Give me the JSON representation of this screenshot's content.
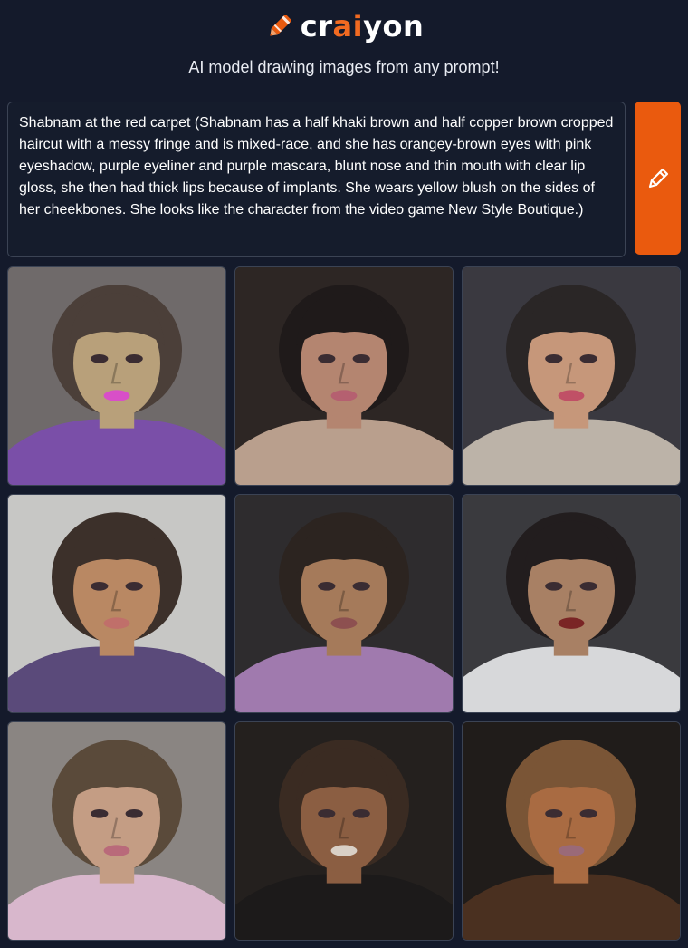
{
  "header": {
    "logo_prefix": "cr",
    "logo_accent": "ai",
    "logo_suffix": "yon",
    "logo_icon": "crayon-pencil-icon",
    "tagline": "AI model drawing images from any prompt!"
  },
  "prompt": {
    "text": "Shabnam at the red carpet (Shabnam has a half khaki brown and half copper brown cropped haircut with a messy fringe and is mixed-race, and she has orangey-brown eyes with pink eyeshadow, purple eyeliner and purple mascara, blunt nose and thin mouth with clear lip gloss, she then had thick lips because of implants. She wears yellow blush on the sides of her cheekbones. She looks like the character from the video game New Style Boutique.)"
  },
  "draw_button": {
    "icon": "pencil-icon"
  },
  "colors": {
    "background": "#141a2b",
    "accent": "#ea5a0e",
    "logo_accent": "#f26a21",
    "border": "#3b4354"
  },
  "images": [
    {
      "label": "generated-image-1",
      "bg": "#6f6a6a",
      "skin": "#b8a07a",
      "hair": "#4b3f39",
      "cloth": "#7a4fa8",
      "lips": "#d84fc8"
    },
    {
      "label": "generated-image-2",
      "bg": "#2d2624",
      "skin": "#b48570",
      "hair": "#1f1a1a",
      "cloth": "#b99f8d",
      "lips": "#b56070"
    },
    {
      "label": "generated-image-3",
      "bg": "#3a3940",
      "skin": "#c6977a",
      "hair": "#2a2626",
      "cloth": "#bcb3a8",
      "lips": "#c05066"
    },
    {
      "label": "generated-image-4",
      "bg": "#c7c7c5",
      "skin": "#b98863",
      "hair": "#3c302a",
      "cloth": "#5a4a7a",
      "lips": "#c06f6a"
    },
    {
      "label": "generated-image-5",
      "bg": "#2e2c2e",
      "skin": "#a57a5a",
      "hair": "#2c2420",
      "cloth": "#a07aae",
      "lips": "#8d5050"
    },
    {
      "label": "generated-image-6",
      "bg": "#3a3a3e",
      "skin": "#a88064",
      "hair": "#221d1e",
      "cloth": "#d7d8da",
      "lips": "#7a2525"
    },
    {
      "label": "generated-image-7",
      "bg": "#8a8582",
      "skin": "#c49d84",
      "hair": "#5a4a3a",
      "cloth": "#d8b7cc",
      "lips": "#b96a7a"
    },
    {
      "label": "generated-image-8",
      "bg": "#24201e",
      "skin": "#8b5e42",
      "hair": "#3a2b22",
      "cloth": "#1c1a1a",
      "lips": "#d9d0c6"
    },
    {
      "label": "generated-image-9",
      "bg": "#201c1a",
      "skin": "#a96b42",
      "hair": "#7a5536",
      "cloth": "#4a3020",
      "lips": "#9a6a78"
    }
  ]
}
